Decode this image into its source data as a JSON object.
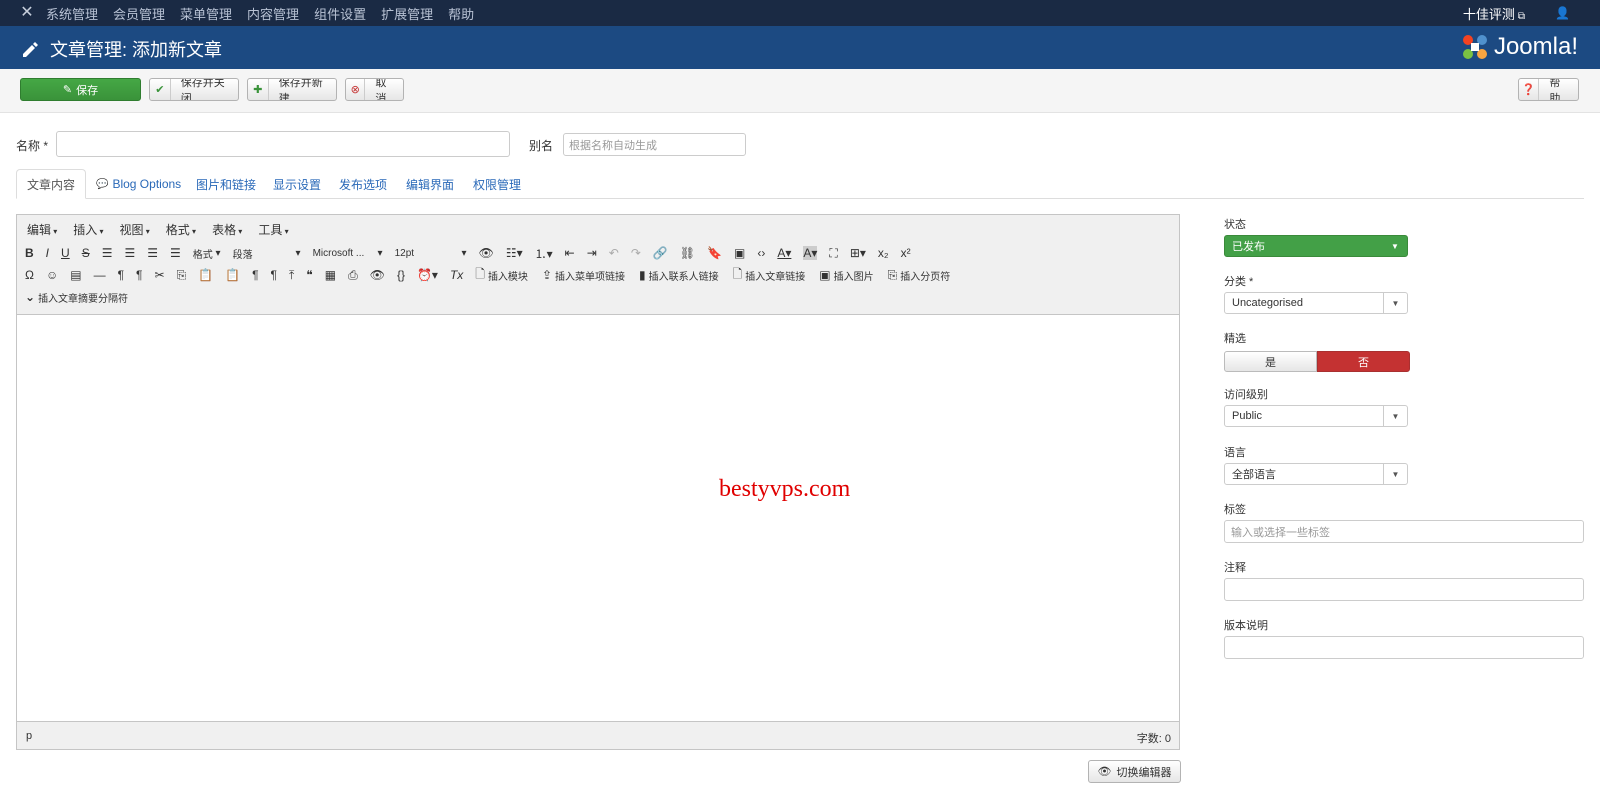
{
  "topnav": {
    "items": [
      "系统管理",
      "会员管理",
      "菜单管理",
      "内容管理",
      "组件设置",
      "扩展管理",
      "帮助"
    ],
    "site": "十佳评测"
  },
  "header": {
    "title": "文章管理: 添加新文章",
    "brand": "Joomla!"
  },
  "toolbar": {
    "save": "保存",
    "save_close": "保存并关闭",
    "save_new": "保存并新建",
    "cancel": "取消",
    "help": "帮助"
  },
  "form": {
    "title_label": "名称 *",
    "title_value": "",
    "alias_label": "别名",
    "alias_placeholder": "根据名称自动生成"
  },
  "tabs": [
    "文章内容",
    "Blog Options",
    "图片和链接",
    "显示设置",
    "发布选项",
    "编辑界面",
    "权限管理"
  ],
  "editor": {
    "menus": [
      "编辑",
      "插入",
      "视图",
      "格式",
      "表格",
      "工具"
    ],
    "formats_label": "格式",
    "block_format": "段落",
    "font_family": "Microsoft ...",
    "font_size": "12pt",
    "insert_buttons": [
      "插入模块",
      "插入菜单项链接",
      "插入联系人链接",
      "插入文章链接",
      "插入图片",
      "插入分页符"
    ],
    "readmore": "插入文章摘要分隔符",
    "watermark": "bestyvps.com",
    "path": "p",
    "word_count": "字数: 0",
    "toggle": "切换编辑器"
  },
  "sidebar": {
    "status_label": "状态",
    "status_value": "已发布",
    "category_label": "分类 *",
    "category_value": "Uncategorised",
    "featured_label": "精选",
    "featured_yes": "是",
    "featured_no": "否",
    "access_label": "访问级别",
    "access_value": "Public",
    "language_label": "语言",
    "language_value": "全部语言",
    "tags_label": "标签",
    "tags_placeholder": "输入或选择一些标签",
    "note_label": "注释",
    "note_value": "",
    "version_label": "版本说明",
    "version_value": ""
  },
  "colors": {
    "topnav": "#1a2a44",
    "header": "#1c4a82",
    "save_green": "#43a047",
    "no_red": "#c43232",
    "link_blue": "#2a69b8",
    "watermark_red": "#e00000"
  }
}
